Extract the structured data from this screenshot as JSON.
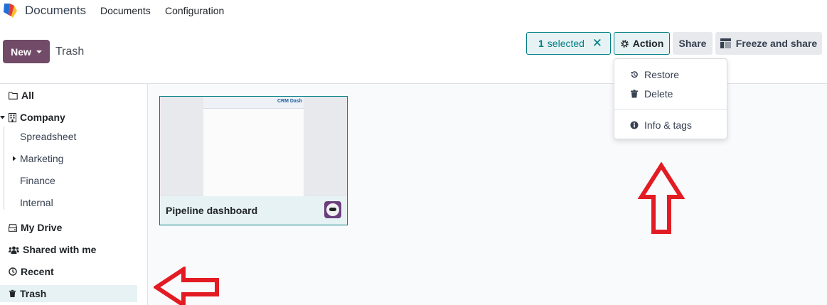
{
  "navbar": {
    "app_title": "Documents",
    "menu": [
      "Documents",
      "Configuration"
    ]
  },
  "control_panel": {
    "new_label": "New",
    "breadcrumb": "Trash",
    "selection": {
      "count": "1",
      "label": "selected"
    },
    "action_label": "Action",
    "share_label": "Share",
    "freeze_share_label": "Freeze and share"
  },
  "action_menu": {
    "items": [
      {
        "label": "Restore",
        "icon": "history-icon"
      },
      {
        "label": "Delete",
        "icon": "trash-icon"
      },
      {
        "label": "Info & tags",
        "icon": "info-circle-icon"
      }
    ]
  },
  "sidebar": {
    "items": [
      {
        "label": "All",
        "icon": "folder-open-icon"
      },
      {
        "label": "Company",
        "icon": "building-icon"
      },
      {
        "label": "Spreadsheet"
      },
      {
        "label": "Marketing"
      },
      {
        "label": "Finance"
      },
      {
        "label": "Internal"
      },
      {
        "label": "My Drive",
        "icon": "hdd-icon"
      },
      {
        "label": "Shared with me",
        "icon": "users-icon"
      },
      {
        "label": "Recent",
        "icon": "clock-icon"
      },
      {
        "label": "Trash",
        "icon": "trash-icon"
      }
    ],
    "active": "Trash"
  },
  "documents": [
    {
      "name": "Pipeline dashboard",
      "thumbnail_text": "CRM Dash"
    }
  ],
  "colors": {
    "brand": "#714B67",
    "accent": "#017e84",
    "annotation_arrow": "#e31b23"
  }
}
